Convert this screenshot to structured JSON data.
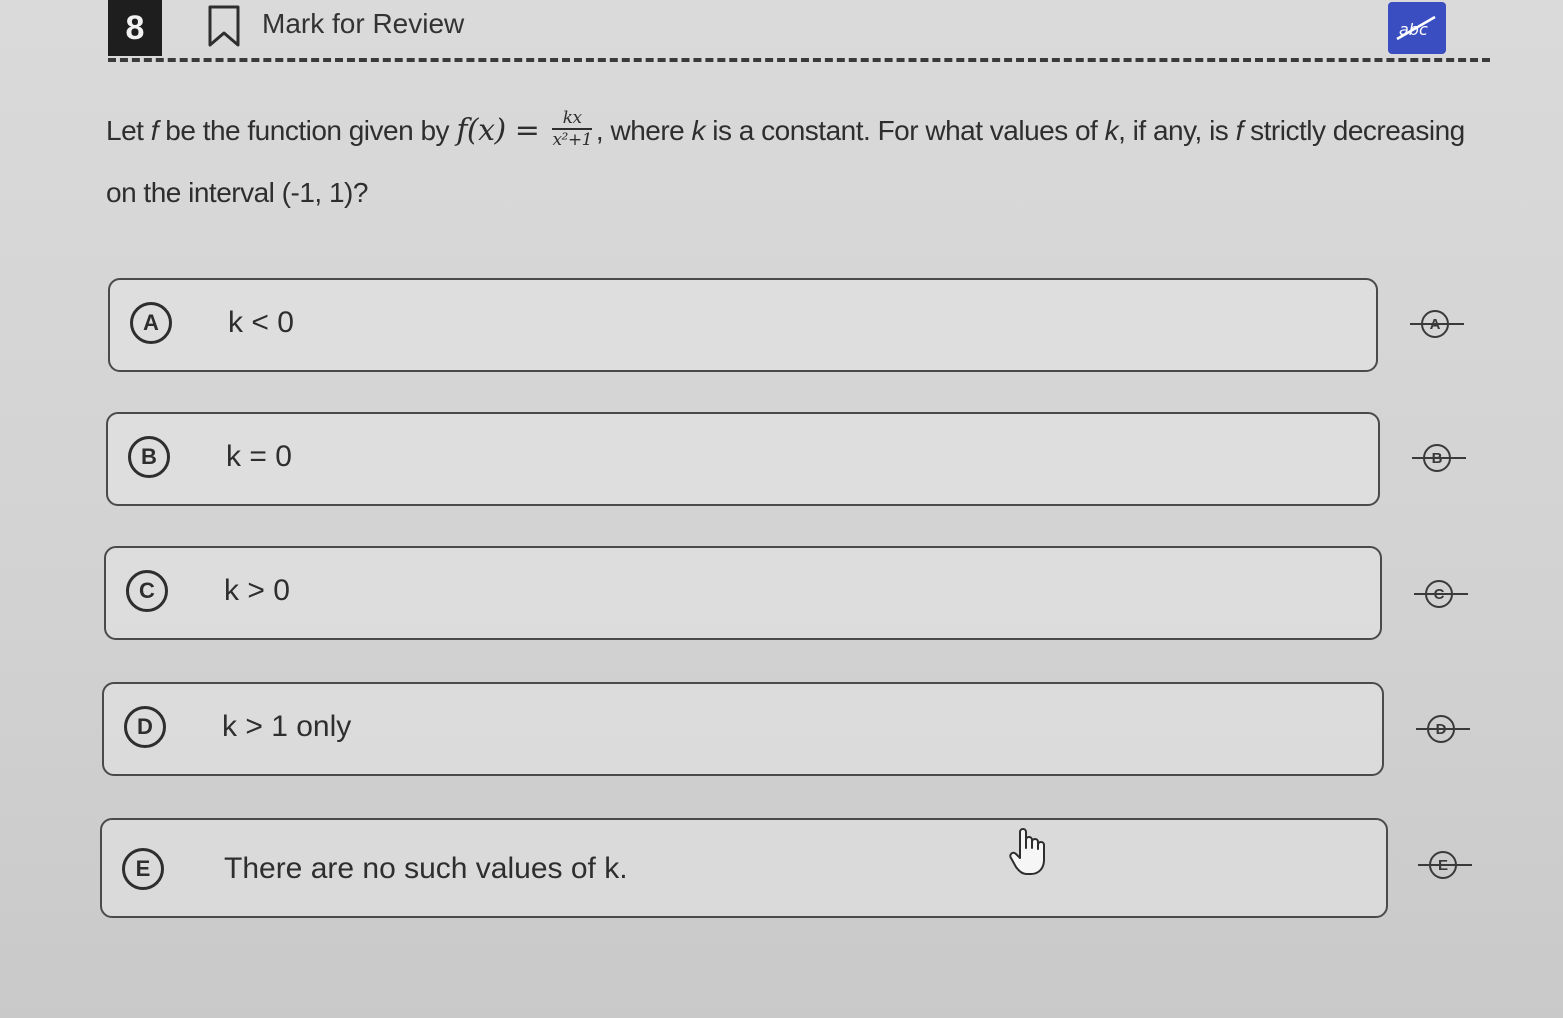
{
  "header": {
    "question_number": "8",
    "mark_for_review_label": "Mark for Review",
    "tool_button_icon": "abc-strikethrough-icon",
    "accent_color": "#3a4ec2"
  },
  "question": {
    "part1": "Let ",
    "f1": "f",
    "part2": " be the function given by ",
    "formula_lhs": "f(x) = ",
    "formula_num": "kx",
    "formula_den": "x²+1",
    "part3": ", where ",
    "k1": "k",
    "part4": " is a constant. For what values of ",
    "k2": "k",
    "part5": ", if any, is ",
    "f2": "f",
    "part6": " strictly decreasing on the interval (-1, 1)?"
  },
  "options": [
    {
      "letter": "A",
      "text": "k < 0"
    },
    {
      "letter": "B",
      "text": "k = 0"
    },
    {
      "letter": "C",
      "text": "k > 0"
    },
    {
      "letter": "D",
      "text": "k > 1 only"
    },
    {
      "letter": "E",
      "text": "There are no such values of k."
    }
  ]
}
